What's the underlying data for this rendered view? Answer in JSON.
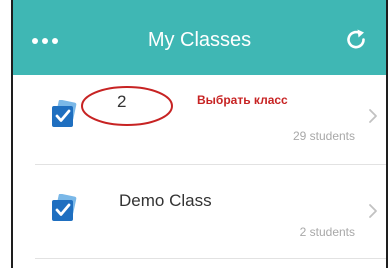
{
  "header": {
    "title": "My Classes",
    "menu_icon": "more-dots-icon",
    "refresh_icon": "refresh-icon",
    "color": "#3fb7b4"
  },
  "classes": [
    {
      "name": "2",
      "students": "29 students",
      "icon": "class-check-icon"
    },
    {
      "name": "Demo Class",
      "students": "2 students",
      "icon": "class-check-icon"
    }
  ],
  "annotation": {
    "text": "Выбрать класс",
    "color": "#c72323"
  }
}
